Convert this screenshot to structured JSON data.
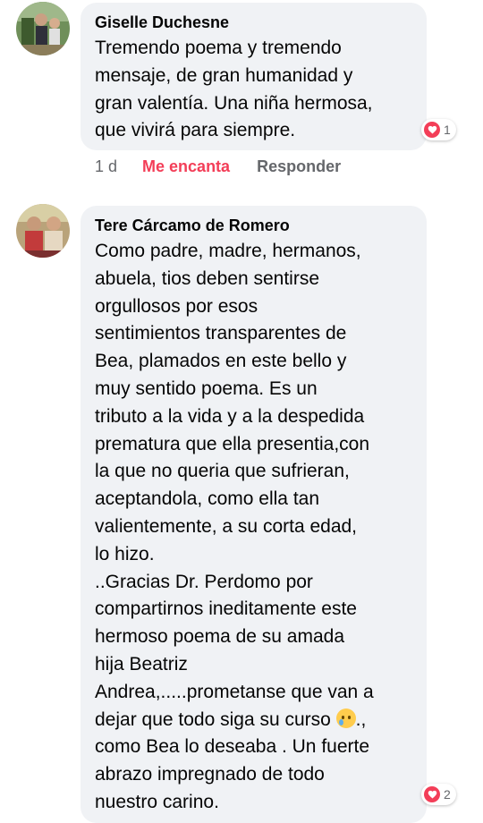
{
  "comments": [
    {
      "author": "Giselle Duchesne",
      "text": "Tremendo poema y tremendo\nmensaje, de gran humanidad y\ngran valentía. Una niña hermosa,\nque vivirá para siempre.",
      "reaction_count": "1",
      "time": "1 d",
      "love_label": "Me encanta",
      "reply_label": "Responder"
    },
    {
      "author": "Tere Cárcamo de Romero",
      "text_before_emoji": "Como padre, madre, hermanos,\nabuela, tios deben sentirse\norgullosos por esos\nsentimientos transparentes de\nBea, plamados en este bello y\nmuy sentido poema. Es un\ntributo a la vida y a la despedida\nprematura que ella presentia,con\nla que no queria que sufrieran,\naceptandola, como ella tan\nvalientemente, a su corta edad,\nlo hizo.\n..Gracias Dr. Perdomo por\ncompartirnos ineditamente este\nhermoso poema de su amada\nhija Beatriz\nAndrea,.....prometanse que van a\ndejar que todo siga su curso ",
      "text_after_emoji": ".,\ncomo Bea lo deseaba . Un fuerte\nabrazo impregnado de todo\nnuestro carino.",
      "reaction_count": "2"
    }
  ],
  "icons": {
    "reaction": "heart-icon",
    "emoji": "crying-face-icon"
  },
  "colors": {
    "bubble": "#f0f2f5",
    "love": "#f33e58",
    "secondary_text": "#65676b"
  }
}
